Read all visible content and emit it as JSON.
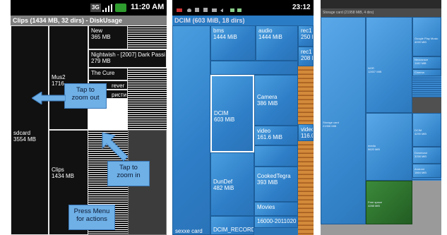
{
  "panel1": {
    "status": {
      "badge": "3G",
      "time": "11:20 AM"
    },
    "title": "Clips (1434 MB, 32 dirs) - DiskUsage",
    "tiles": {
      "sdcard": [
        "sdcard",
        "3554 MB"
      ],
      "mus2": [
        "Mus2",
        "1716"
      ],
      "new": [
        "New",
        "365 MB"
      ],
      "nightwish": [
        "Nightwish - [2007] Dark Passi",
        "279 MB"
      ],
      "thecure": [
        "The Cure"
      ],
      "forever": [
        "rever"
      ],
      "cyrillic": [
        "ристи"
      ],
      "clips": [
        "Clips",
        "1434 MB"
      ]
    },
    "callouts": {
      "zoom_out": "Tap to zoom out",
      "zoom_in": "Tap to zoom in",
      "menu": "Press Menu for actions"
    }
  },
  "panel2": {
    "status": {
      "time": "23:12"
    },
    "title": "DCIM (603 MiB, 18 dirs)",
    "tiles": {
      "bms": [
        "bms",
        "1444 MiB"
      ],
      "audio": [
        "audio",
        "1444 MiB"
      ],
      "rec1": [
        "rec1",
        "250 M"
      ],
      "rec2": [
        "rec1",
        "208 M"
      ],
      "dcim": [
        "DCIM",
        "603 MiB"
      ],
      "camera": [
        "Camera",
        "386 MiB"
      ],
      "video": [
        "video",
        "161.6 MiB"
      ],
      "video2": [
        "video",
        "116.0"
      ],
      "dundef": [
        "DunDef",
        "482 MiB"
      ],
      "cooked": [
        "CookedTegra",
        "393 MiB"
      ],
      "movies": [
        "Movies"
      ],
      "bottom1": [
        "16000-2011020"
      ],
      "bottom2": [
        "DCIM_RECORDER"
      ],
      "bottom3": [
        "sexxe card"
      ]
    }
  },
  "panel3": {
    "title": "Storage card (21958 MiB, 4 dirs)",
    "tiles": {
      "storage": [
        "Storage card",
        "21958 MiB"
      ],
      "music": [
        "NOR",
        "12837 MiB"
      ],
      "media": [
        "media",
        "9620 MiB"
      ],
      "free": [
        "Free space",
        "4288 MiB"
      ],
      "gplay": [
        "Google Play Music",
        "4099 MiB"
      ],
      "rt1": [
        "Nexusrace",
        "1182 MiB"
      ],
      "rt2": [
        "Cinema"
      ],
      "dcim": [
        "DCIM",
        "4290 MiB"
      ],
      "download": [
        "Download",
        "3258 MiB"
      ],
      "android": [
        "Android",
        "1864 MiB"
      ]
    }
  }
}
